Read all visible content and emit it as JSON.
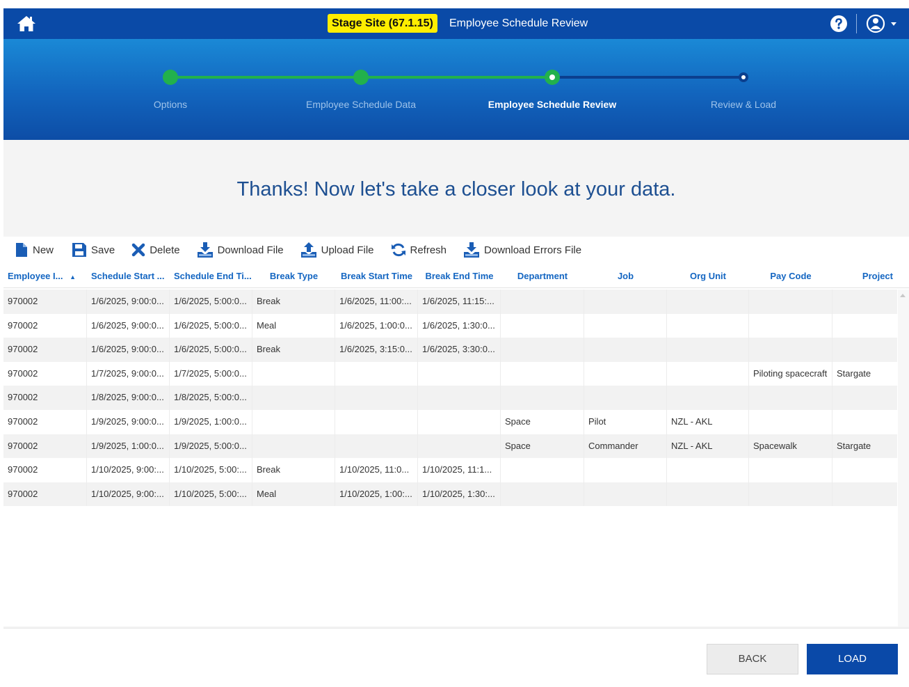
{
  "header": {
    "stage_badge": "Stage Site (67.1.15)",
    "title": "Employee Schedule Review"
  },
  "colors": {
    "topbar": "#0a4aa7",
    "stepper_done": "#22b14c",
    "badge": "#ffee00",
    "header_text": "#1466c2",
    "headline": "#1d4f91",
    "primary_button": "#0a49a8"
  },
  "stepper": {
    "steps": [
      {
        "label": "Options",
        "state": "done"
      },
      {
        "label": "Employee Schedule Data",
        "state": "done"
      },
      {
        "label": "Employee Schedule Review",
        "state": "current"
      },
      {
        "label": "Review & Load",
        "state": "todo"
      }
    ]
  },
  "headline": "Thanks! Now let's take a closer look at your data.",
  "toolbar": {
    "new": "New",
    "save": "Save",
    "delete": "Delete",
    "download_file": "Download File",
    "upload_file": "Upload File",
    "refresh": "Refresh",
    "download_errors": "Download Errors File"
  },
  "grid": {
    "columns": [
      "Employee I...",
      "Schedule Start ...",
      "Schedule End Ti...",
      "Break Type",
      "Break Start Time",
      "Break End Time",
      "Department",
      "Job",
      "Org Unit",
      "Pay Code",
      "Project"
    ],
    "sort_indicator": "▲",
    "rows": [
      [
        "970002",
        "1/6/2025, 9:00:0...",
        "1/6/2025, 5:00:0...",
        "Break",
        "1/6/2025, 11:00:...",
        "1/6/2025, 11:15:...",
        "",
        "",
        "",
        "",
        ""
      ],
      [
        "970002",
        "1/6/2025, 9:00:0...",
        "1/6/2025, 5:00:0...",
        "Meal",
        "1/6/2025, 1:00:0...",
        "1/6/2025, 1:30:0...",
        "",
        "",
        "",
        "",
        ""
      ],
      [
        "970002",
        "1/6/2025, 9:00:0...",
        "1/6/2025, 5:00:0...",
        "Break",
        "1/6/2025, 3:15:0...",
        "1/6/2025, 3:30:0...",
        "",
        "",
        "",
        "",
        ""
      ],
      [
        "970002",
        "1/7/2025, 9:00:0...",
        "1/7/2025, 5:00:0...",
        "",
        "",
        "",
        "",
        "",
        "",
        "Piloting spacecraft",
        "Stargate"
      ],
      [
        "970002",
        "1/8/2025, 9:00:0...",
        "1/8/2025, 5:00:0...",
        "",
        "",
        "",
        "",
        "",
        "",
        "",
        ""
      ],
      [
        "970002",
        "1/9/2025, 9:00:0...",
        "1/9/2025, 1:00:0...",
        "",
        "",
        "",
        "Space",
        "Pilot",
        "NZL - AKL",
        "",
        ""
      ],
      [
        "970002",
        "1/9/2025, 1:00:0...",
        "1/9/2025, 5:00:0...",
        "",
        "",
        "",
        "Space",
        "Commander",
        "NZL - AKL",
        "Spacewalk",
        "Stargate"
      ],
      [
        "970002",
        "1/10/2025, 9:00:...",
        "1/10/2025, 5:00:...",
        "Break",
        "1/10/2025, 11:0...",
        "1/10/2025, 11:1...",
        "",
        "",
        "",
        "",
        ""
      ],
      [
        "970002",
        "1/10/2025, 9:00:...",
        "1/10/2025, 5:00:...",
        "Meal",
        "1/10/2025, 1:00:...",
        "1/10/2025, 1:30:...",
        "",
        "",
        "",
        "",
        ""
      ]
    ]
  },
  "footer": {
    "back": "BACK",
    "load": "LOAD"
  }
}
